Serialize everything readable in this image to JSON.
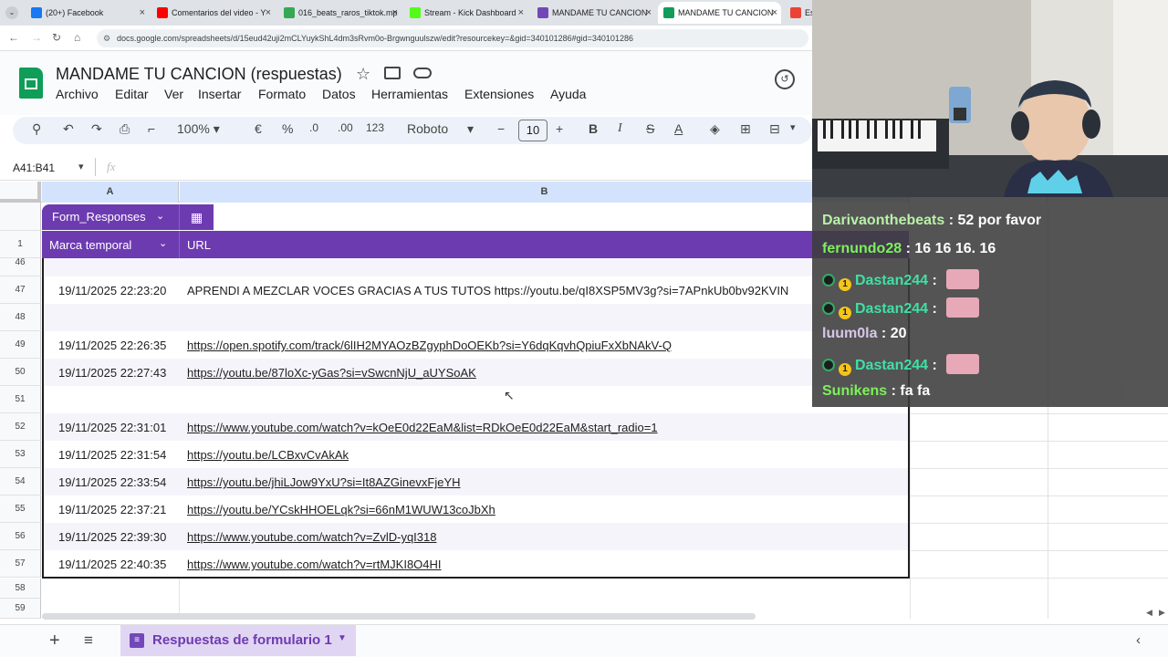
{
  "browser": {
    "tabs": [
      {
        "label": "(20+) Facebook",
        "color": "#1877f2"
      },
      {
        "label": "Comentarios del video - Y",
        "color": "#ff0000"
      },
      {
        "label": "016_beats_raros_tiktok.mp",
        "color": "#34a853"
      },
      {
        "label": "Stream - Kick Dashboard",
        "color": "#53fc18"
      },
      {
        "label": "MANDAME TU CANCION",
        "color": "#7248b9"
      },
      {
        "label": "MANDAME TU CANCION",
        "color": "#0f9d58"
      },
      {
        "label": "Esc",
        "color": "#ea4335"
      }
    ],
    "url": "docs.google.com/spreadsheets/d/15eud42uji2mCLYuykShL4dm3sRvm0o-Brgwnguulszw/edit?resourcekey=&gid=340101286#gid=340101286"
  },
  "doc": {
    "title": "MANDAME TU CANCION  (respuestas)",
    "menu": [
      "Archivo",
      "Editar",
      "Ver",
      "Insertar",
      "Formato",
      "Datos",
      "Herramientas",
      "Extensiones",
      "Ayuda"
    ]
  },
  "toolbar": {
    "zoom": "100%",
    "currency": "€",
    "percent": "%",
    "dec_minus": ".0",
    "dec_plus": ".00",
    "number_format": "123",
    "font": "Roboto",
    "font_size": "10",
    "bold": "B",
    "italic": "I",
    "strike": "S",
    "text_color": "A"
  },
  "formula_bar": {
    "name_box": "A41:B41",
    "fx": "fx"
  },
  "grid": {
    "col_a": "A",
    "col_b": "B",
    "table_name": "Form_Responses",
    "headers": [
      "Marca temporal",
      "URL"
    ],
    "header_row_num": "1",
    "rows": [
      {
        "num": "46",
        "ts": "",
        "url": ""
      },
      {
        "num": "47",
        "ts": "19/11/2025 22:23:20",
        "url": "APRENDI A MEZCLAR VOCES GRACIAS A TUS TUTOS https://youtu.be/qI8XSP5MV3g?si=7APnkUb0bv92KVIN"
      },
      {
        "num": "48",
        "ts": "",
        "url": ""
      },
      {
        "num": "49",
        "ts": "19/11/2025 22:26:35",
        "url": "https://open.spotify.com/track/6lIH2MYAOzBZgyphDoOEKb?si=Y6dqKqvhQpiuFxXbNAkV-Q"
      },
      {
        "num": "50",
        "ts": "19/11/2025 22:27:43",
        "url": "https://youtu.be/87loXc-yGas?si=vSwcnNjU_aUYSoAK"
      },
      {
        "num": "51",
        "ts": "",
        "url": ""
      },
      {
        "num": "52",
        "ts": "19/11/2025 22:31:01",
        "url": "https://www.youtube.com/watch?v=kOeE0d22EaM&list=RDkOeE0d22EaM&start_radio=1"
      },
      {
        "num": "53",
        "ts": "19/11/2025 22:31:54",
        "url": "https://youtu.be/LCBxvCvAkAk"
      },
      {
        "num": "54",
        "ts": "19/11/2025 22:33:54",
        "url": "https://youtu.be/jhiLJow9YxU?si=It8AZGinevxFjeYH"
      },
      {
        "num": "55",
        "ts": "19/11/2025 22:37:21",
        "url": "https://youtu.be/YCskHHOELqk?si=66nM1WUW13coJbXh"
      },
      {
        "num": "56",
        "ts": "19/11/2025 22:39:30",
        "url": "https://www.youtube.com/watch?v=ZvlD-yqI318"
      },
      {
        "num": "57",
        "ts": "19/11/2025 22:40:35",
        "url": "https://www.youtube.com/watch?v=rtMJKI8O4HI"
      }
    ],
    "empty_rows": [
      "58",
      "59"
    ]
  },
  "sheet_tab": {
    "label": "Respuestas de formulario 1"
  },
  "chat": {
    "messages": [
      {
        "user": "Darivaonthebeats",
        "user_color": "#b8f0a8",
        "msg": "52 por favor",
        "badges": false,
        "emote": false
      },
      {
        "user": "fernundo28",
        "user_color": "#7cf05a",
        "msg": "16 16 16. 16",
        "badges": false,
        "emote": false
      },
      {
        "user": "Dastan244",
        "user_color": "#3fe0a5",
        "msg": "",
        "badges": true,
        "emote": true
      },
      {
        "user": "Dastan244",
        "user_color": "#3fe0a5",
        "msg": "",
        "badges": true,
        "emote": true
      },
      {
        "user": "luum0la",
        "user_color": "#d7c6e8",
        "msg": "20",
        "badges": false,
        "emote": false
      },
      {
        "user": "Dastan244",
        "user_color": "#3fe0a5",
        "msg": "",
        "badges": true,
        "emote": true
      },
      {
        "user": "Sunikens",
        "user_color": "#7cf05a",
        "msg": "fa fa",
        "badges": false,
        "emote": false
      }
    ],
    "badge_text": "1"
  }
}
